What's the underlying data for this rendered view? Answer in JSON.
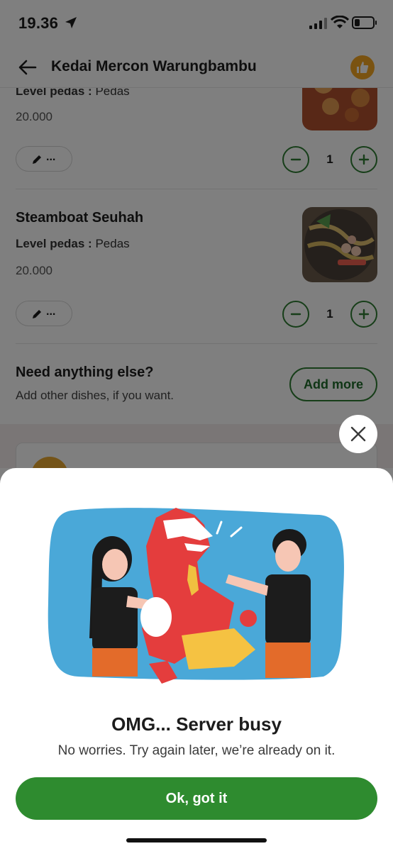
{
  "status_bar": {
    "time": "19.36"
  },
  "header": {
    "title": "Kedai Mercon Warungbambu"
  },
  "items": [
    {
      "level_label": "Level pedas :",
      "level_value": "Pedas",
      "price": "20.000",
      "note": "...",
      "qty": "1"
    },
    {
      "name": "Steamboat Seuhah",
      "level_label": "Level pedas :",
      "level_value": "Pedas",
      "price": "20.000",
      "note": "...",
      "qty": "1"
    }
  ],
  "need_more": {
    "title": "Need anything else?",
    "subtitle": "Add other dishes, if you want.",
    "button": "Add more"
  },
  "dialog": {
    "title": "OMG... Server busy",
    "message": "No worries. Try again later, we’re already on it.",
    "ok_button": "Ok, got it"
  },
  "colors": {
    "primary_green": "#2e8b2f",
    "accent_orange": "#f5a623",
    "illustration_bg": "#4aa8d8",
    "dino_red": "#e43d3d"
  }
}
